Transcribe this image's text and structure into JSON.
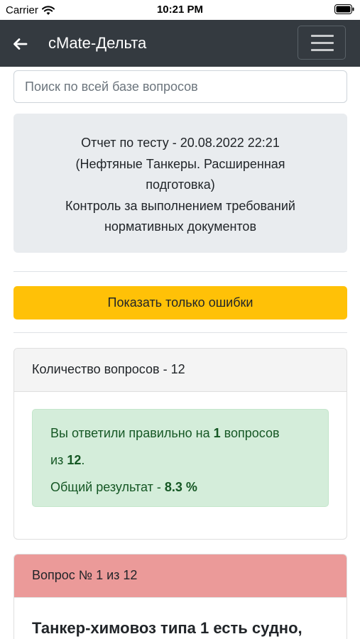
{
  "status_bar": {
    "carrier": "Carrier",
    "time": "10:21 PM"
  },
  "navbar": {
    "title": "cMate-Дельта",
    "icons": {
      "back": "arrow-left-icon",
      "menu": "hamburger-menu-icon"
    }
  },
  "search": {
    "placeholder": "Поиск по всей базе вопросов"
  },
  "report": {
    "lines": [
      "Отчет по тесту - 20.08.2022 22:21",
      "(Нефтяные Танкеры. Расширенная",
      "подготовка)",
      "Контроль за выполнением требований",
      "нормативных документов"
    ]
  },
  "filter_button": {
    "label": "Показать только ошибки"
  },
  "summary": {
    "header": "Количество вопросов - 12",
    "answered_prefix": "Вы ответили правильно на ",
    "correct_count": "1",
    "answered_mid": " вопросов",
    "from_prefix": "из ",
    "total": "12",
    "from_suffix": ".",
    "result_label": "Общий результат - ",
    "result_value": "8.3 %"
  },
  "question": {
    "header": "Вопрос № 1 из 12",
    "text": "Танкер-химовоз типа 1 есть судно,"
  },
  "colors": {
    "navbar": "#343a40",
    "warning": "#ffc107",
    "success_bg": "#d4edda",
    "success_text": "#155724",
    "danger_header": "#eb9a99",
    "jumbotron": "#e9ecef"
  }
}
